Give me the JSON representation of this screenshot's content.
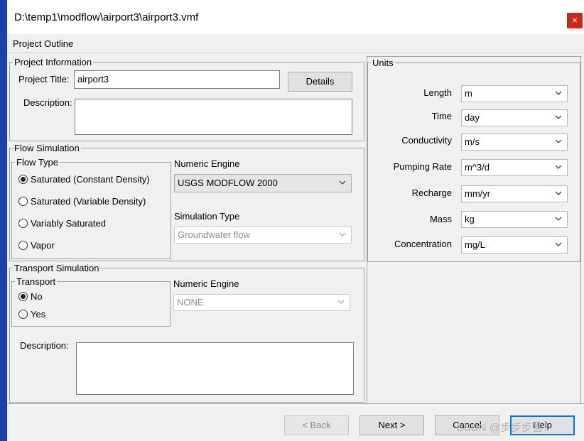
{
  "window": {
    "title": "D:\\temp1\\modflow\\airport3\\airport3.vmf",
    "close_glyph": "×"
  },
  "outline": {
    "label": "Project Outline"
  },
  "project_info": {
    "group_title": "Project Information",
    "title_label": "Project Title:",
    "title_value": "airport3",
    "details_button": "Details",
    "description_label": "Description:",
    "description_value": ""
  },
  "flow_sim": {
    "group_title": "Flow Simulation",
    "flow_type_title": "Flow Type",
    "options": [
      {
        "label": "Saturated (Constant Density)",
        "checked": true
      },
      {
        "label": "Saturated (Variable Density)",
        "checked": false
      },
      {
        "label": "Variably Saturated",
        "checked": false
      },
      {
        "label": "Vapor",
        "checked": false
      }
    ],
    "engine_label": "Numeric Engine",
    "engine_value": "USGS MODFLOW 2000",
    "sim_type_label": "Simulation Type",
    "sim_type_value": "Groundwater flow"
  },
  "transport_sim": {
    "group_title": "Transport Simulation",
    "transport_title": "Transport",
    "options": [
      {
        "label": "No",
        "checked": true
      },
      {
        "label": "Yes",
        "checked": false
      }
    ],
    "engine_label": "Numeric Engine",
    "engine_value": "NONE",
    "description_label": "Description:",
    "description_value": ""
  },
  "units": {
    "group_title": "Units",
    "rows": [
      {
        "label": "Length",
        "value": "m"
      },
      {
        "label": "Time",
        "value": "day"
      },
      {
        "label": "Conductivity",
        "value": "m/s"
      },
      {
        "label": "Pumping Rate",
        "value": "m^3/d"
      },
      {
        "label": "Recharge",
        "value": "mm/yr"
      },
      {
        "label": "Mass",
        "value": "kg"
      },
      {
        "label": "Concentration",
        "value": "mg/L"
      }
    ]
  },
  "footer": {
    "back": "< Back",
    "next": "Next >",
    "cancel": "Cancel",
    "help": "Help",
    "watermark": "CSDN @步步步营！"
  },
  "colors": {
    "desktop": "#1f3fa8",
    "close": "#c42b1c",
    "focus_border": "#0078d7"
  }
}
